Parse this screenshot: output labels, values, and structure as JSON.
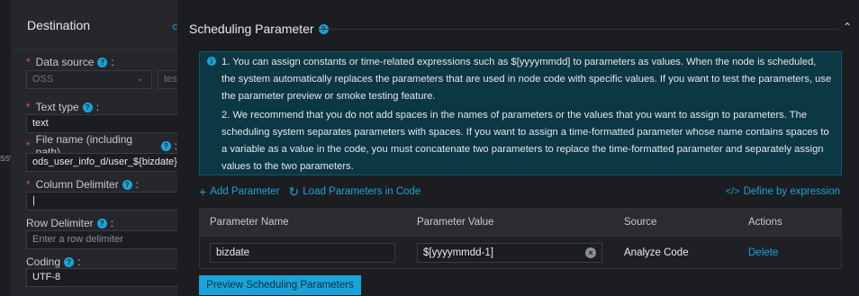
{
  "left": {
    "edge_text": "ssw",
    "title": "Destination",
    "collapse_char": "c",
    "data_source": {
      "label": "Data source",
      "value": "OSS",
      "second_value": "test"
    },
    "text_type": {
      "label": "Text type",
      "value": "text"
    },
    "file_name": {
      "label": "File name (including path)",
      "value": "ods_user_info_d/user_${bizdate}"
    },
    "column_delimiter": {
      "label": "Column Delimiter",
      "value": "|"
    },
    "row_delimiter": {
      "label": "Row Delimiter",
      "placeholder": "Enter a row delimiter"
    },
    "coding": {
      "label": "Coding",
      "value": "UTF-8"
    }
  },
  "section": {
    "title": "Scheduling Parameter"
  },
  "notice": {
    "p1": "1. You can assign constants or time-related expressions such as $[yyyymmdd] to parameters as values. When the node is scheduled, the system automatically replaces the parameters that are used in node code with specific values. If you want to test the parameters, use the parameter preview or smoke testing feature.",
    "p2": "2. We recommend that you do not add spaces in the names of parameters or the values that you want to assign to parameters. The scheduling system separates parameters with spaces. If you want to assign a time-formatted parameter whose name contains spaces to a variable as a value in the code, you must concatenate two parameters to replace the time-formatted parameter and separately assign values to the two parameters."
  },
  "toolbar": {
    "add_parameter": "Add Parameter",
    "load_parameters": "Load Parameters in Code",
    "define_by_expression": "Define by expression"
  },
  "table": {
    "headers": [
      "Parameter Name",
      "Parameter Value",
      "Source",
      "Actions"
    ],
    "rows": [
      {
        "name": "bizdate",
        "value": "$[yyyymmdd-1]",
        "source": "Analyze Code",
        "action": "Delete"
      }
    ]
  },
  "preview_button": "Preview Scheduling Parameters",
  "colors": {
    "accent": "#1aa3d9",
    "notice_bg": "#0c3843",
    "required": "#e05050"
  }
}
